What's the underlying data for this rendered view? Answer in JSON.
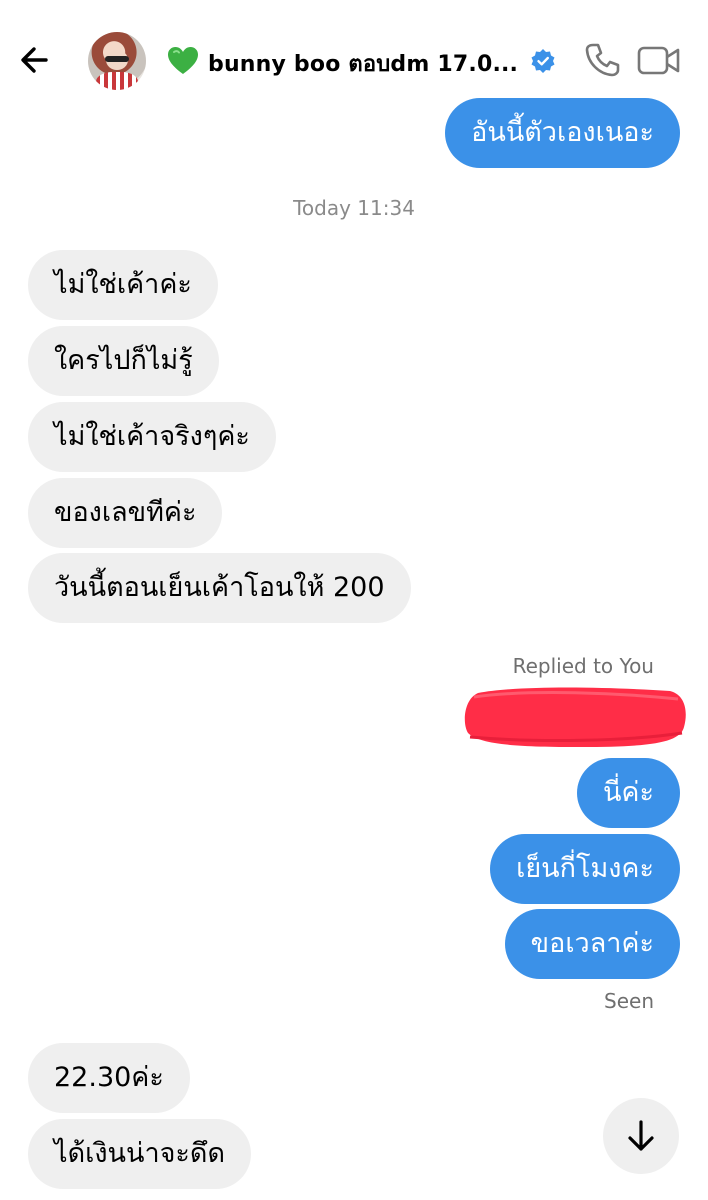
{
  "header": {
    "title": "bunny boo ตอบdm 17.0...",
    "back_icon": "arrow-left-icon",
    "heart_icon": "green-heart-emoji",
    "verified_icon": "verified-badge-icon",
    "call_icon": "phone-icon",
    "video_icon": "video-camera-icon"
  },
  "messages": {
    "top_out": "อันนี้ตัวเองเนอะ",
    "timestamp": "Today 11:34",
    "in_1": "ไม่ใช่เค้าค่ะ",
    "in_2": "ใครไปก็ไม่รู้",
    "in_3": "ไม่ใช่เค้าจริงๆค่ะ",
    "in_4": "ของเลขทีค่ะ",
    "in_5": "วันนี้ตอนเย็นเค้าโอนให้ 200",
    "replied_label": "Replied to You",
    "out_1": "นี่ค่ะ",
    "out_2": "เย็นกี่โมงคะ",
    "out_3": "ขอเวลาค่ะ",
    "seen_label": "Seen",
    "in_6": "22.30ค่ะ",
    "in_7": "ได้เงินน่าจะดึด"
  },
  "colors": {
    "outgoing_bubble": "#3b91e8",
    "incoming_bubble": "#efefef",
    "redaction": "#ff2d47",
    "verified": "#3b91e8",
    "heart": "#3cb043"
  },
  "scroll_icon": "arrow-down-icon"
}
